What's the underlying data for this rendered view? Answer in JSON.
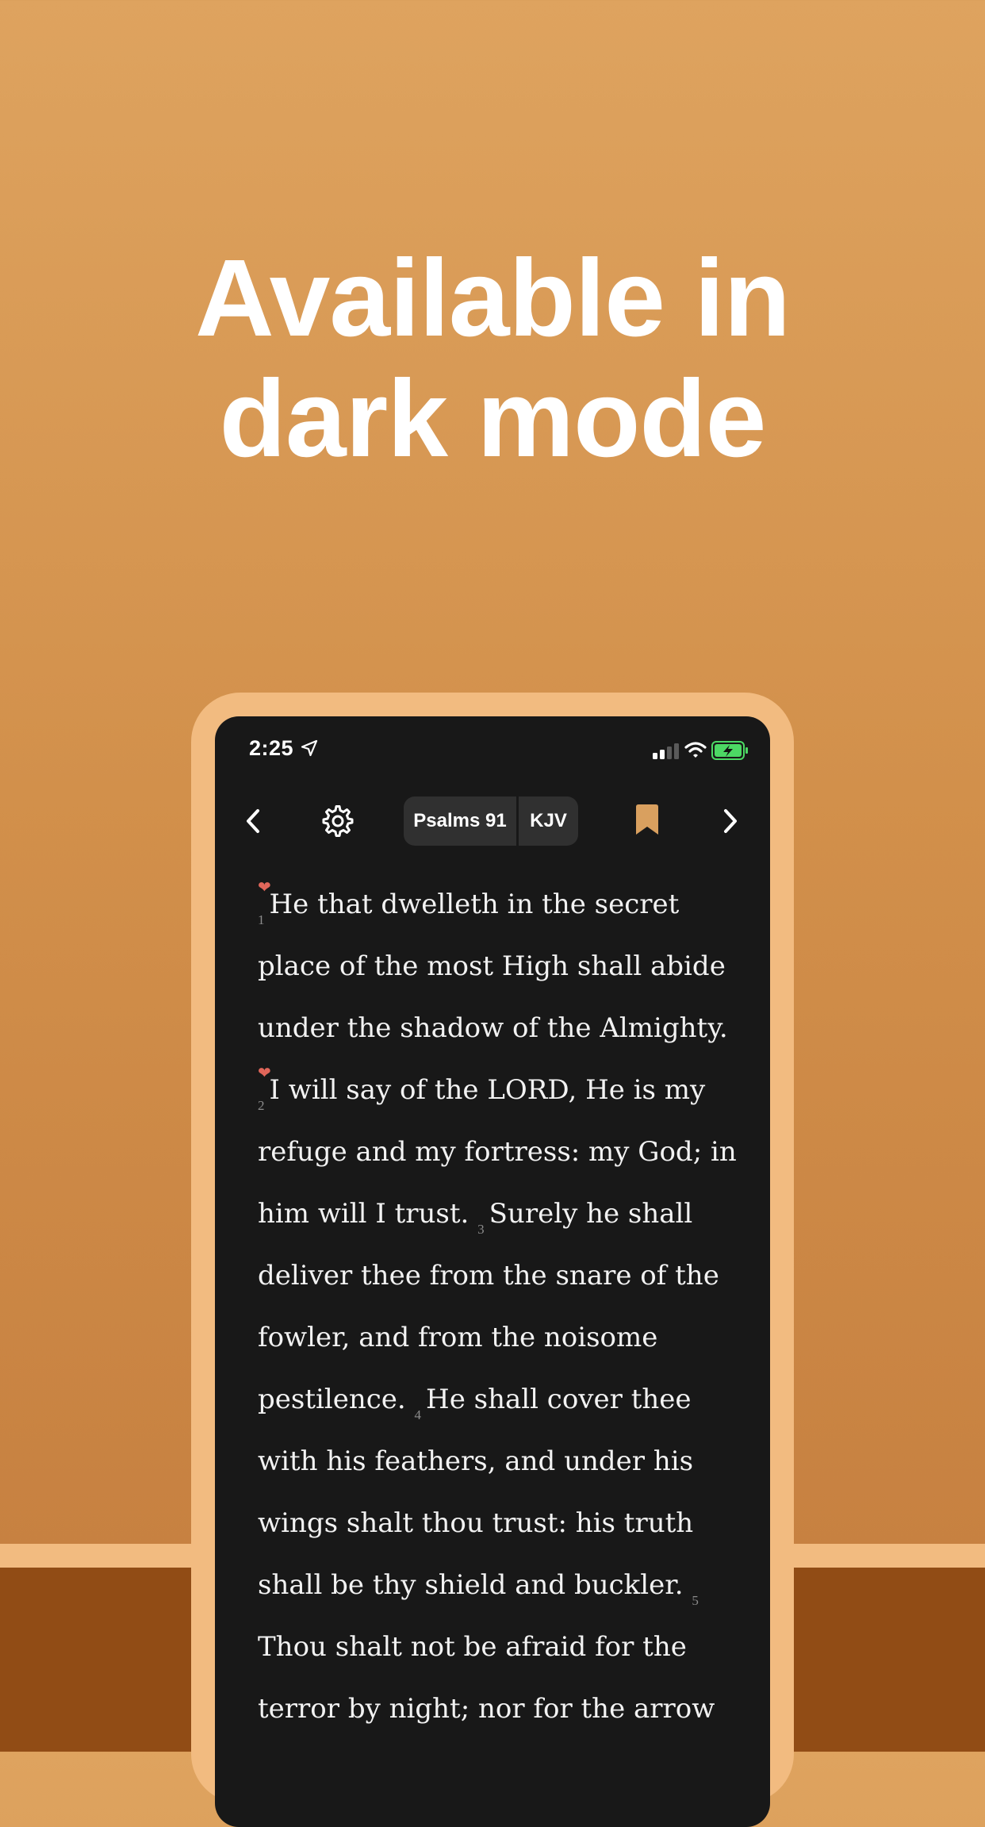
{
  "headline": {
    "line1": "Available in",
    "line2": "dark mode"
  },
  "status_bar": {
    "time": "2:25"
  },
  "toolbar": {
    "book": "Psalms 91",
    "version": "KJV"
  },
  "passage": {
    "lines": [
      [
        "He that dwelleth in the secret"
      ],
      [
        "place of the most High shall abide"
      ],
      [
        "under the shadow of the Almighty."
      ],
      [
        "I will say of the LORD, He is my"
      ],
      [
        "refuge and my fortress: my God; in"
      ],
      [
        "him will I trust.",
        "Surely he shall"
      ],
      [
        "deliver thee from the snare of the"
      ],
      [
        "fowler, and from the noisome"
      ],
      [
        "pestilence.",
        "He shall cover thee"
      ],
      [
        "with his feathers, and under his"
      ],
      [
        "wings shalt thou trust: his truth"
      ],
      [
        "shall be thy shield and buckler."
      ],
      [
        "Thou shalt not be afraid for the"
      ],
      [
        "terror by night; nor for the arrow"
      ]
    ],
    "verse_numbers": [
      "1",
      "2",
      "3",
      "4",
      "5"
    ]
  },
  "colors": {
    "bg_top": "#dea35f",
    "bg_bottom": "#c47d3e",
    "frame": "#f2bb80",
    "ground": "#914c15",
    "screen": "#181818",
    "bookmark": "#d9a05f",
    "heart": "#e0665a",
    "battery": "#4cd964"
  },
  "icons": [
    "location-arrow-icon",
    "signal-icon",
    "wifi-icon",
    "battery-icon",
    "chevron-left-icon",
    "gear-icon",
    "bookmark-icon",
    "chevron-right-icon",
    "heart-icon"
  ]
}
